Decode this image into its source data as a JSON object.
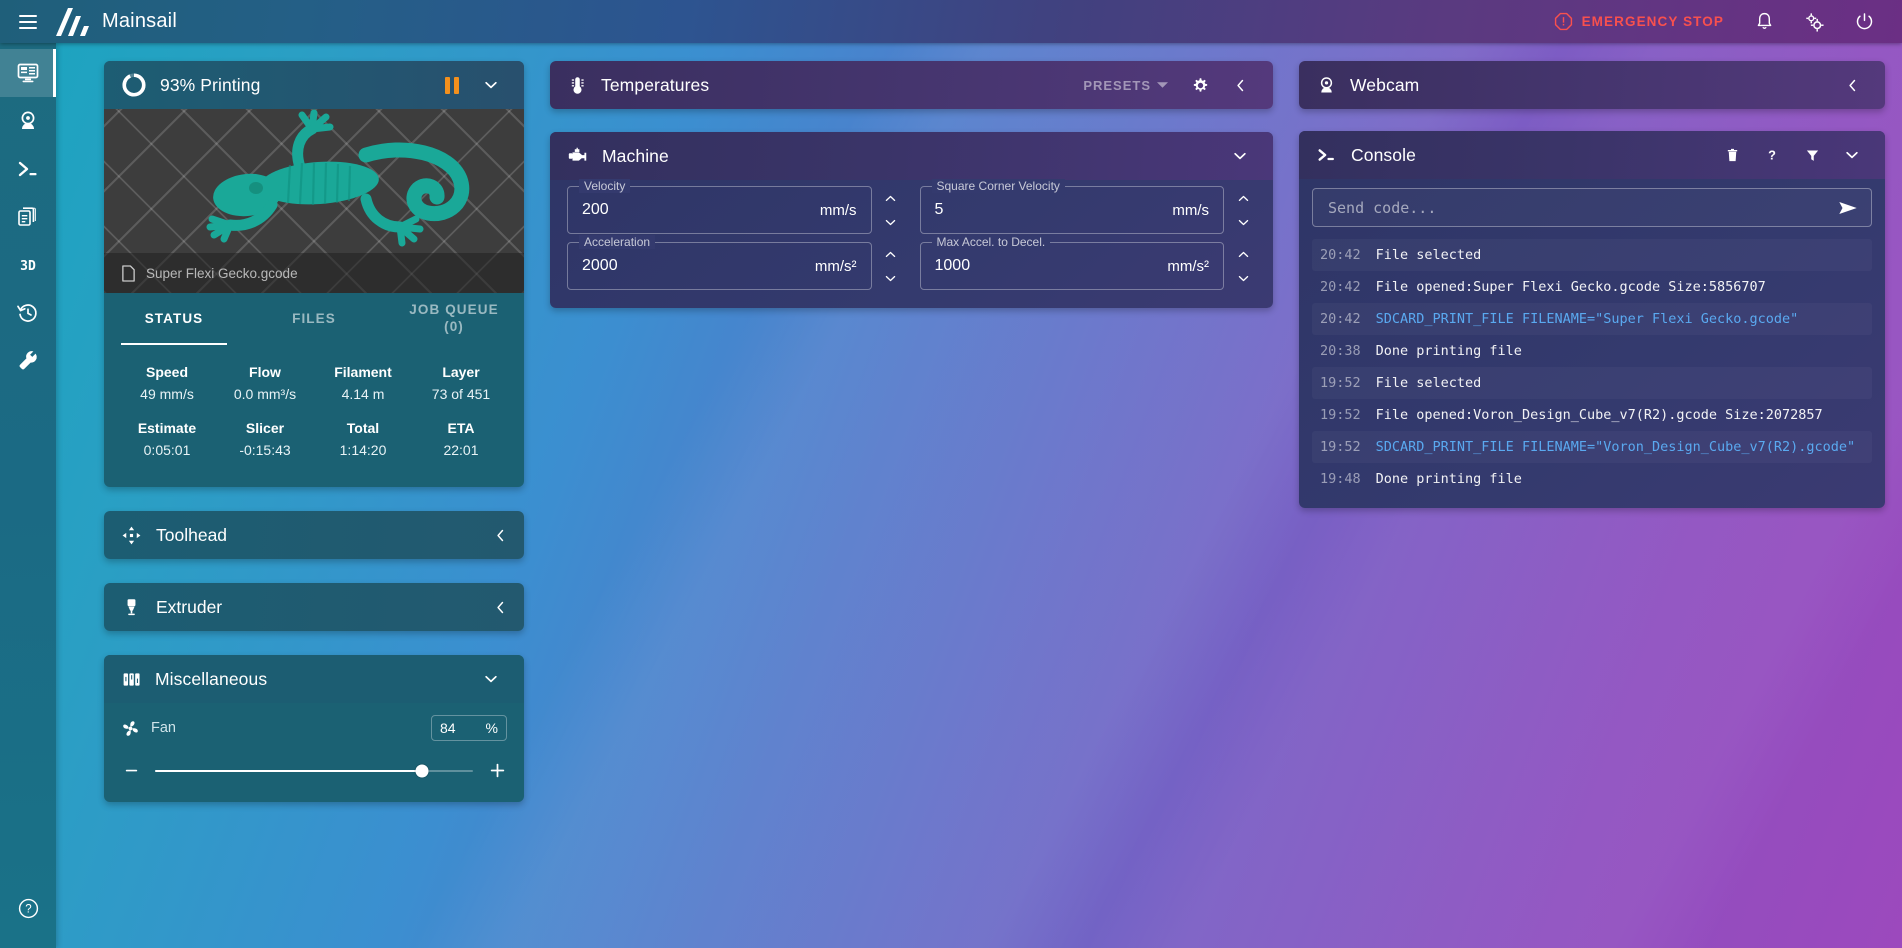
{
  "app": {
    "name": "Mainsail",
    "menu_icon": "hamburger-icon",
    "logo_icon": "mainsail-logo-icon"
  },
  "header": {
    "emergency_stop": "EMERGENCY STOP",
    "emergency_icon": "alert-octagon-icon",
    "notifications_icon": "bell-icon",
    "settings_icon": "gears-icon",
    "power_icon": "power-icon",
    "emergency_color": "#f8504e"
  },
  "sidebar": {
    "items": [
      {
        "name": "dashboard",
        "icon": "monitor-dashboard-icon",
        "active": true
      },
      {
        "name": "webcam",
        "icon": "webcam-icon",
        "active": false
      },
      {
        "name": "console",
        "icon": "console-prompt-icon",
        "active": false
      },
      {
        "name": "files",
        "icon": "file-documents-icon",
        "active": false
      },
      {
        "name": "3d-viewer",
        "icon": "3d-icon",
        "label": "3D",
        "active": false
      },
      {
        "name": "history",
        "icon": "history-clock-icon",
        "active": false
      },
      {
        "name": "machine-settings",
        "icon": "wrench-icon",
        "active": false
      }
    ],
    "help_icon": "help-circle-icon"
  },
  "status_card": {
    "title": "93% Printing",
    "progress_percent": 93,
    "progress_icon": "progress-ring-icon",
    "pause_icon": "pause-icon",
    "pause_color": "#f3901d",
    "collapse_icon": "chevron-down-icon",
    "file_icon": "file-icon",
    "filename": "Super Flexi Gecko.gcode",
    "tabs": [
      {
        "label": "STATUS",
        "active": true
      },
      {
        "label": "FILES",
        "active": false
      },
      {
        "label": "JOB QUEUE",
        "sub": "(0)",
        "active": false
      }
    ],
    "stats": [
      [
        {
          "key": "Speed",
          "value": "49 mm/s"
        },
        {
          "key": "Flow",
          "value": "0.0 mm³/s"
        },
        {
          "key": "Filament",
          "value": "4.14 m"
        },
        {
          "key": "Layer",
          "value": "73 of 451"
        }
      ],
      [
        {
          "key": "Estimate",
          "value": "0:05:01"
        },
        {
          "key": "Slicer",
          "value": "-0:15:43"
        },
        {
          "key": "Total",
          "value": "1:14:20"
        },
        {
          "key": "ETA",
          "value": "22:01"
        }
      ]
    ]
  },
  "toolhead": {
    "title": "Toolhead",
    "icon": "toolhead-crosshair-icon",
    "collapse_icon": "chevron-left-icon"
  },
  "extruder": {
    "title": "Extruder",
    "icon": "extruder-icon",
    "collapse_icon": "chevron-left-icon"
  },
  "miscellaneous": {
    "title": "Miscellaneous",
    "icon": "sliders-icon",
    "collapse_icon": "chevron-down-icon",
    "fan": {
      "label": "Fan",
      "icon": "fan-icon",
      "value": "84",
      "unit": "%",
      "percent": 84,
      "minus_icon": "minus-icon",
      "plus_icon": "plus-icon"
    }
  },
  "temperatures": {
    "title": "Temperatures",
    "icon": "thermometer-icon",
    "presets_label": "PRESETS",
    "presets_caret_icon": "caret-down-icon",
    "settings_icon": "gear-icon",
    "collapse_icon": "chevron-left-icon"
  },
  "machine": {
    "title": "Machine",
    "icon": "engine-icon",
    "collapse_icon": "chevron-down-icon",
    "fields": [
      {
        "label": "Velocity",
        "value": "200",
        "unit": "mm/s"
      },
      {
        "label": "Square Corner Velocity",
        "value": "5",
        "unit": "mm/s"
      },
      {
        "label": "Acceleration",
        "value": "2000",
        "unit": "mm/s²"
      },
      {
        "label": "Max Accel. to Decel.",
        "value": "1000",
        "unit": "mm/s²"
      }
    ],
    "up_icon": "chevron-up-icon",
    "down_icon": "chevron-down-icon"
  },
  "webcam": {
    "title": "Webcam",
    "icon": "webcam-icon",
    "collapse_icon": "chevron-left-icon"
  },
  "console": {
    "title": "Console",
    "icon": "console-prompt-icon",
    "clear_icon": "trash-icon",
    "help_icon": "question-mark-icon",
    "filter_icon": "filter-icon",
    "collapse_icon": "chevron-down-icon",
    "send_placeholder": "Send code...",
    "send_value": "",
    "send_icon": "send-icon",
    "lines": [
      {
        "time": "20:42",
        "message": "File selected",
        "type": "response"
      },
      {
        "time": "20:42",
        "message": "File opened:Super Flexi Gecko.gcode Size:5856707",
        "type": "response"
      },
      {
        "time": "20:42",
        "message": "SDCARD_PRINT_FILE FILENAME=\"Super Flexi Gecko.gcode\"",
        "type": "command"
      },
      {
        "time": "20:38",
        "message": "Done printing file",
        "type": "response"
      },
      {
        "time": "19:52",
        "message": "File selected",
        "type": "response"
      },
      {
        "time": "19:52",
        "message": "File opened:Voron_Design_Cube_v7(R2).gcode Size:2072857",
        "type": "response"
      },
      {
        "time": "19:52",
        "message": "SDCARD_PRINT_FILE FILENAME=\"Voron_Design_Cube_v7(R2).gcode\"",
        "type": "command"
      },
      {
        "time": "19:48",
        "message": "Done printing file",
        "type": "response"
      }
    ]
  }
}
